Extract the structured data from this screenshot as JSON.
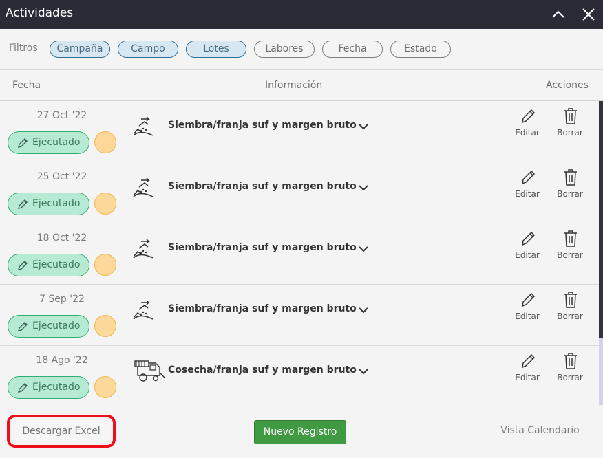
{
  "window": {
    "title": "Actividades",
    "collapse_icon": "chevron-up-icon",
    "close_icon": "close-icon"
  },
  "filters": {
    "label": "Filtros",
    "chips": [
      {
        "label": "Campaña",
        "active": true
      },
      {
        "label": "Campo",
        "active": true
      },
      {
        "label": "Lotes",
        "active": true
      },
      {
        "label": "Labores",
        "active": false
      },
      {
        "label": "Fecha",
        "active": false
      },
      {
        "label": "Estado",
        "active": false
      }
    ]
  },
  "table": {
    "headers": {
      "date": "Fecha",
      "info": "Información",
      "actions": "Acciones"
    },
    "rows": [
      {
        "date": "27 Oct '22",
        "status": "Ejecutado",
        "icon": "sowing-icon",
        "title": "Siembra/franja suf y margen bruto",
        "edit": "Editar",
        "delete": "Borrar"
      },
      {
        "date": "25 Oct '22",
        "status": "Ejecutado",
        "icon": "sowing-icon",
        "title": "Siembra/franja suf y margen bruto",
        "edit": "Editar",
        "delete": "Borrar"
      },
      {
        "date": "18 Oct '22",
        "status": "Ejecutado",
        "icon": "sowing-icon",
        "title": "Siembra/franja suf y margen bruto",
        "edit": "Editar",
        "delete": "Borrar"
      },
      {
        "date": "7 Sep '22",
        "status": "Ejecutado",
        "icon": "sowing-icon",
        "title": "Siembra/franja suf y margen bruto",
        "edit": "Editar",
        "delete": "Borrar"
      },
      {
        "date": "18 Ago '22",
        "status": "Ejecutado",
        "icon": "harvester-icon",
        "title": "Cosecha/franja suf y margen bruto",
        "edit": "Editar",
        "delete": "Borrar"
      }
    ]
  },
  "footer": {
    "excel_label": "Descargar Excel",
    "new_label": "Nuevo Registro",
    "calendar_label": "Vista Calendario"
  },
  "colors": {
    "titlebar": "#2b2b38",
    "status_bg": "#b7ead3",
    "status_border": "#2fae76",
    "pending_circle": "#fcd89a",
    "primary_button": "#3f9a41",
    "highlight": "#ee0e1a"
  }
}
